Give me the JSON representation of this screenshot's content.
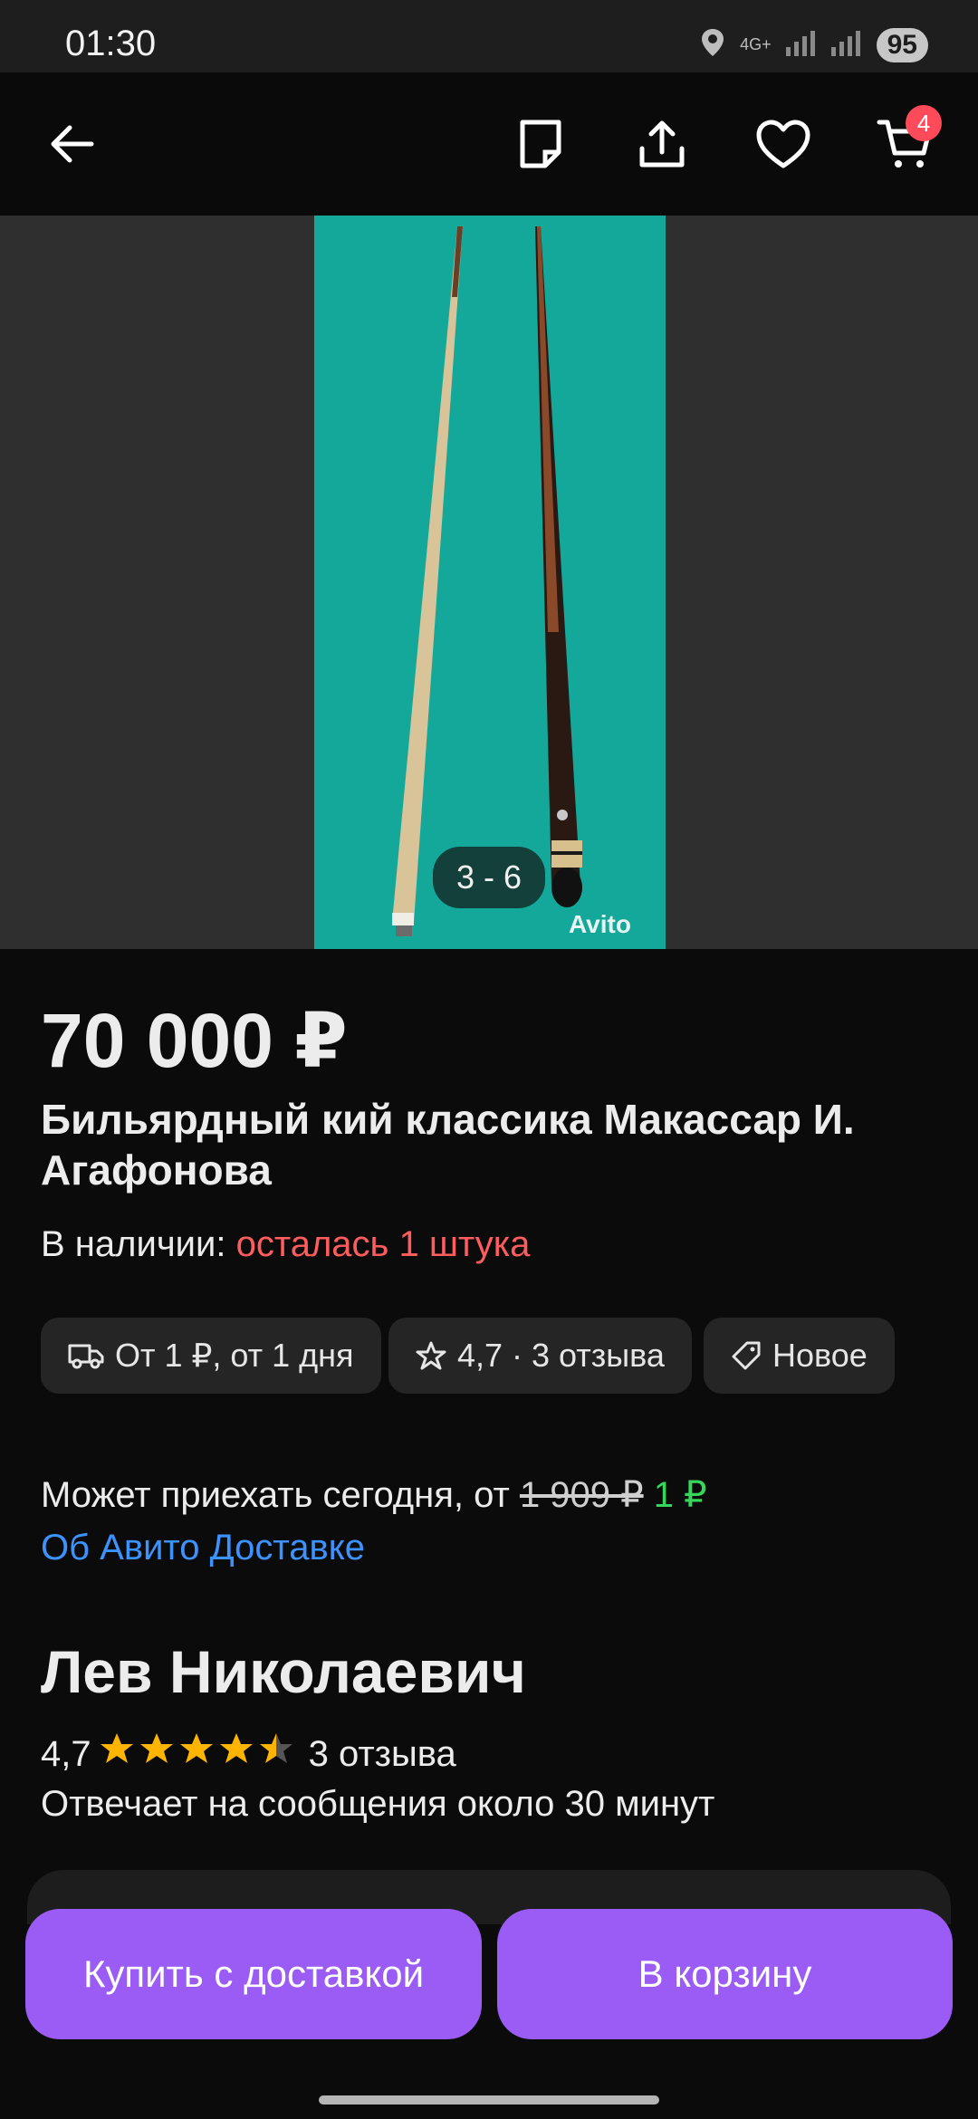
{
  "status_bar": {
    "time": "01:30",
    "network": "4G+",
    "battery": "95"
  },
  "cart": {
    "badge_count": "4"
  },
  "gallery": {
    "counter": "3 - 6",
    "watermark": "Avito",
    "bg_color": "#14a89a"
  },
  "product": {
    "price": "70 000 ₽",
    "title": "Бильярдный кий классика Макассар И. Агафонова",
    "availability_label": "В наличии:",
    "availability_value": "осталась 1 штука"
  },
  "chips": [
    {
      "icon": "truck-icon",
      "label": "От 1 ₽, от 1 дня"
    },
    {
      "icon": "star-outline-icon",
      "label": "4,7 · 3 отзыва"
    },
    {
      "icon": "tag-icon",
      "label": "Новое"
    }
  ],
  "delivery": {
    "text": "Может приехать сегодня, от",
    "old_price": "1 909 ₽",
    "new_price": "1 ₽",
    "link": "Об Авито Доставке"
  },
  "seller": {
    "name": "Лев Николаевич",
    "rating": "4,7",
    "rating_stars": 4.5,
    "reviews": "3 отзыва",
    "reply_time": "Отвечает на сообщения около 30 минут"
  },
  "actions": {
    "buy_label": "Купить с доставкой",
    "cart_label": "В корзину"
  },
  "colors": {
    "accent": "#9b5cf6",
    "badge": "#ff4b59",
    "link": "#3c93ff",
    "stock_red": "#ff5d5d",
    "discount_green": "#36d65a"
  }
}
